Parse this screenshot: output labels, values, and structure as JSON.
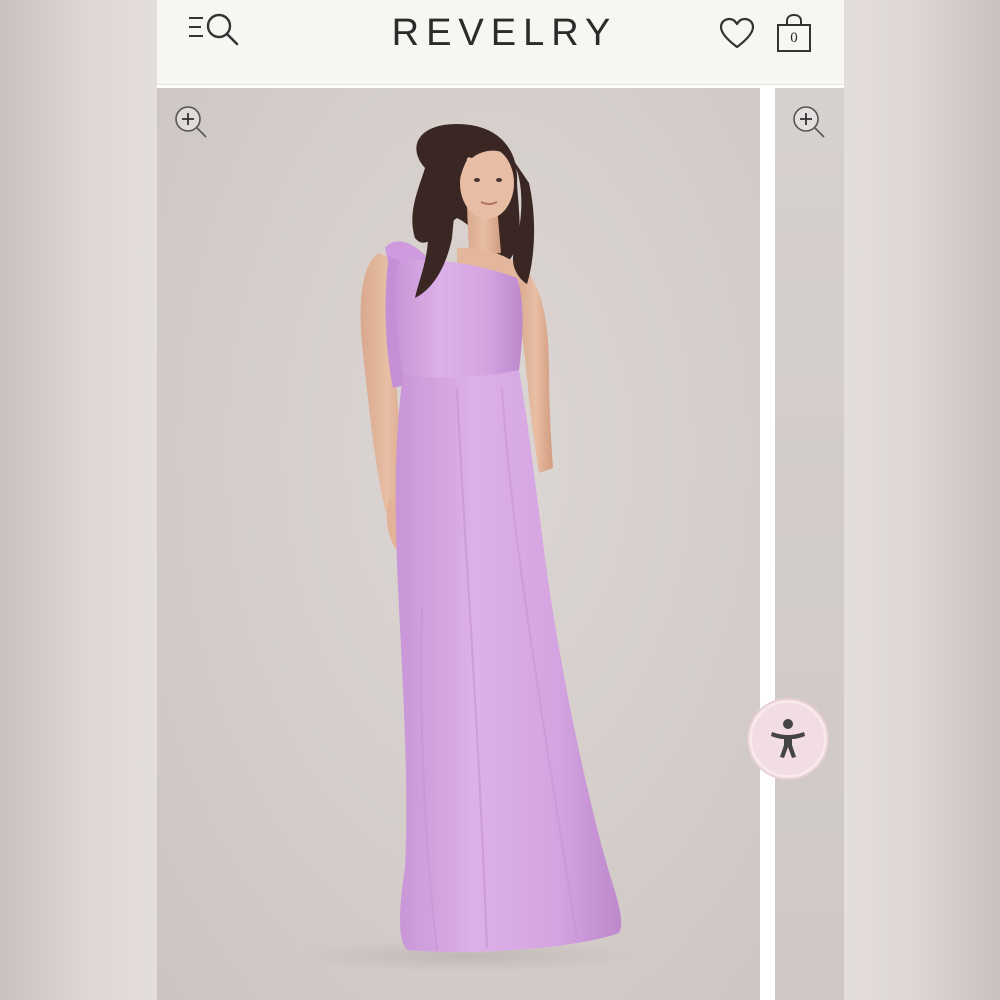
{
  "header": {
    "brand": "REVELRY",
    "cart_count": "0"
  },
  "icons": {
    "menu": "menu-search-icon",
    "wishlist": "heart-icon",
    "cart": "shopping-bag-icon",
    "zoom": "zoom-in-icon",
    "accessibility": "accessibility-person-icon"
  },
  "colors": {
    "dress": "#d8a8e4",
    "header_bg": "#f7f6f3",
    "accessibility_bg": "#f1dde2"
  }
}
